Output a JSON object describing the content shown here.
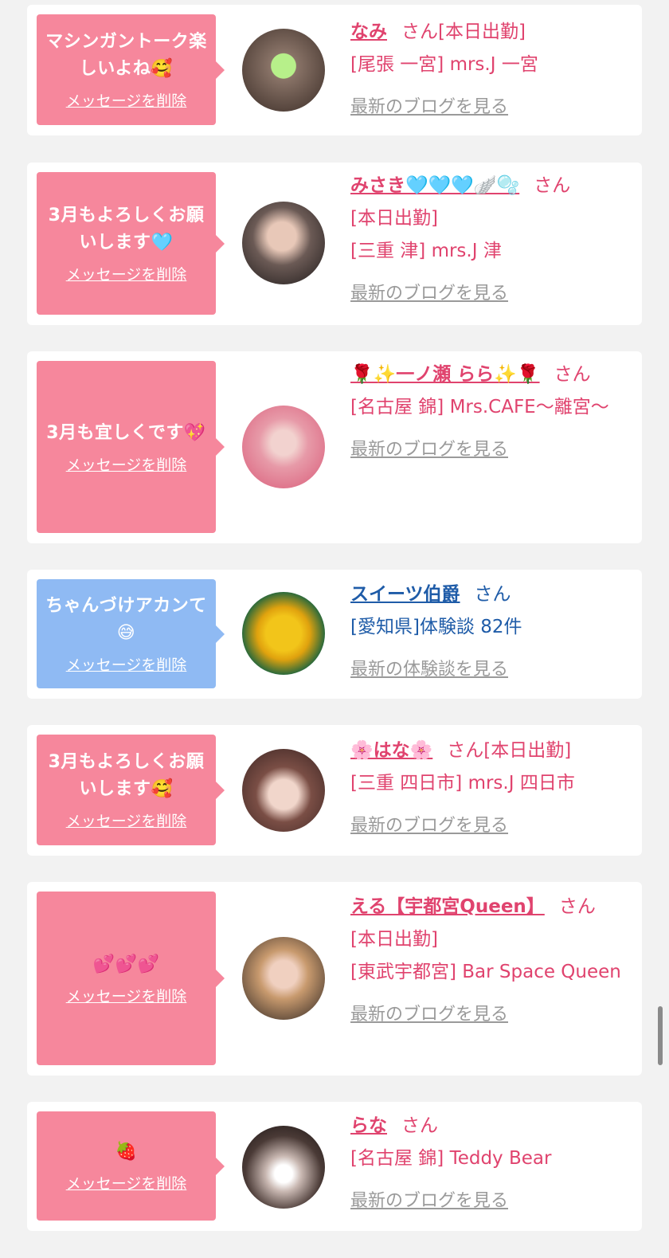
{
  "delete_label": "メッセージを削除",
  "cards": [
    {
      "message": "マシンガントーク楽しいよね🥰",
      "name": "なみ",
      "san": "さん",
      "line1": "[本日出勤]",
      "line2": "[尾張 一宮] mrs.J 一宮",
      "link": "最新のブログを見る"
    },
    {
      "message": "3月もよろしくお願いします🩵",
      "name": "みさき🩵🩵🩵🪽🫧",
      "san": "さん",
      "line1": "[本日出勤]",
      "line2": "[三重 津] mrs.J 津",
      "link": "最新のブログを見る"
    },
    {
      "message": "3月も宜しくです💖",
      "name": "🌹✨一ノ瀬 らら✨🌹",
      "san": "さん",
      "line1": "[名古屋 錦] Mrs.CAFE～離宮～",
      "link": "最新のブログを見る"
    },
    {
      "message": "ちゃんづけアカンて😅",
      "name": "スイーツ伯爵",
      "san": "さん",
      "line1": "[愛知県]体験談 82件",
      "link": "最新の体験談を見る"
    },
    {
      "message": "3月もよろしくお願いします🥰",
      "name": "🌸はな🌸",
      "san": "さん",
      "line1": "[本日出勤]",
      "line2": "[三重 四日市] mrs.J 四日市",
      "link": "最新のブログを見る"
    },
    {
      "message": "💕💕💕",
      "name": "える【宇都宮Queen】",
      "san": "さん",
      "line1": "[本日出勤]",
      "line2": "[東武宇都宮] Bar Space Queen",
      "link": "最新のブログを見る"
    },
    {
      "message": "🍓",
      "name": "らな",
      "san": "さん",
      "line1": "[名古屋 錦] Teddy Bear",
      "link": "最新のブログを見る"
    }
  ],
  "colors": {
    "pink_bubble": "#f6879c",
    "blue_bubble": "#8fbaf3",
    "pink_text": "#e0436e",
    "blue_text": "#1f5ca8",
    "link_gray": "#9a9a9a"
  }
}
